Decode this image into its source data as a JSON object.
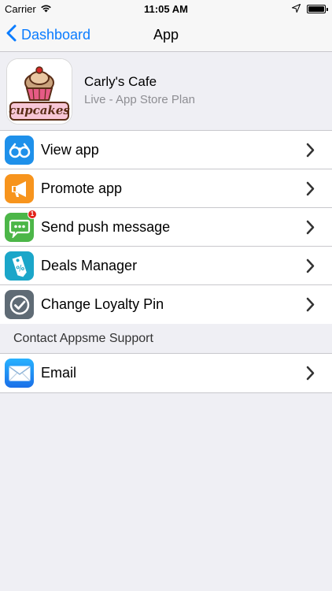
{
  "status_bar": {
    "carrier": "Carrier",
    "time": "11:05 AM"
  },
  "nav": {
    "back_label": "Dashboard",
    "title": "App"
  },
  "app": {
    "name": "Carly's Cafe",
    "plan": "Live - App Store Plan",
    "logo_text": "cupcakes"
  },
  "menu": {
    "items": [
      {
        "label": "View app",
        "icon": "binoculars-icon",
        "color": "#1e90ea"
      },
      {
        "label": "Promote app",
        "icon": "megaphone-icon",
        "color": "#f7941d"
      },
      {
        "label": "Send push message",
        "icon": "chat-bubble-icon",
        "color": "#4cb648",
        "badge": "1"
      },
      {
        "label": "Deals Manager",
        "icon": "price-tag-icon",
        "color": "#1ba6c9"
      },
      {
        "label": "Change Loyalty Pin",
        "icon": "checkmark-icon",
        "color": "#5f6b75"
      }
    ]
  },
  "support": {
    "header": "Contact Appsme Support",
    "items": [
      {
        "label": "Email",
        "icon": "envelope-icon",
        "color": "#1a8cf0"
      }
    ]
  },
  "colors": {
    "accent": "#0a7cff",
    "background": "#efeff4"
  }
}
